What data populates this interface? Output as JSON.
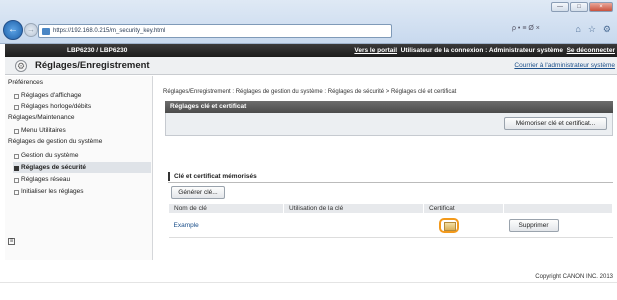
{
  "browser": {
    "url": "https://192.168.0.215/m_security_key.html",
    "toolbar_glyphs": "ρ • ≡ Ø ×",
    "win_buttons": [
      "—",
      "□",
      "×"
    ],
    "nav_icons": [
      "⌂",
      "☆",
      "⚙"
    ]
  },
  "header": {
    "model": "LBP6230 / LBP6230",
    "portal_link": "Vers le portail",
    "user_label": "Utilisateur de la connexion : Administrateur système",
    "logout_link": "Se déconnecter"
  },
  "title_row": {
    "title": "Réglages/Enregistrement",
    "return_link": "Courrier à l'administrateur système"
  },
  "sidebar": {
    "group1": "Préférences",
    "g1_items": [
      "Réglages d'affichage",
      "Réglages horloge/débits"
    ],
    "group2": "Réglages/Maintenance",
    "g2_items": [
      "Menu Utilitaires"
    ],
    "group3": "Réglages de gestion du système",
    "g3_items": [
      "Gestion du système",
      "Réglages de sécurité",
      "Réglages réseau",
      "Initialiser les réglages"
    ]
  },
  "main": {
    "breadcrumb": "Réglages/Enregistrement : Réglages de gestion du système : Réglages de sécurité > Réglages clé et certificat",
    "panel_title": "Réglages clé et certificat",
    "register_button": "Mémoriser clé et certificat...",
    "section_title": "Clé et certificat mémorisés",
    "generate_button": "Générer clé...",
    "table": {
      "headers": [
        "Nom de clé",
        "Utilisation de la clé",
        "Certificat",
        ""
      ],
      "rows": [
        {
          "key_name": "Example",
          "usage": "",
          "delete": "Supprimer"
        }
      ]
    },
    "copyright": "Copyright CANON INC. 2013"
  }
}
